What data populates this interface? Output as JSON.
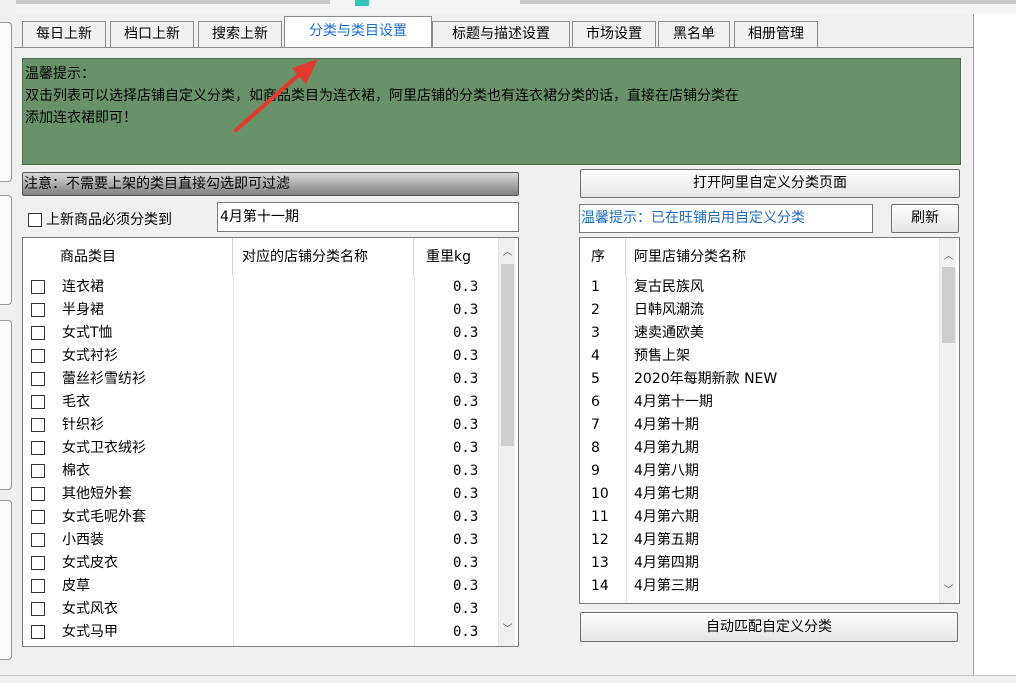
{
  "tabs": [
    "每日上新",
    "档口上新",
    "搜索上新",
    "分类与类目设置",
    "标题与描述设置",
    "市场设置",
    "黑名单",
    "相册管理"
  ],
  "active_tab_index": 3,
  "notice": {
    "title": "温馨提示：",
    "line1": "双击列表可以选择店铺自定义分类，如商品类目为连衣裙，阿里店铺的分类也有连衣裙分类的话，直接在店铺分类在",
    "line2": "添加连衣裙即可！"
  },
  "filter_hint": "注意：不需要上架的类目直接勾选即可过滤",
  "must_classify_label": "上新商品必须分类到",
  "must_classify_checked": false,
  "must_classify_value": "4月第十一期",
  "open_ali_button": "打开阿里自定义分类页面",
  "ali_hint": "温馨提示：已在旺铺启用自定义分类",
  "refresh_button": "刷新",
  "auto_match_button": "自动匹配自定义分类",
  "category_grid": {
    "headers": [
      "商品类目",
      "对应的店铺分类名称",
      "重里kg"
    ],
    "rows": [
      {
        "name": "连衣裙",
        "shop": "",
        "weight": "0.3"
      },
      {
        "name": "半身裙",
        "shop": "",
        "weight": "0.3"
      },
      {
        "name": "女式T恤",
        "shop": "",
        "weight": "0.3"
      },
      {
        "name": "女式衬衫",
        "shop": "",
        "weight": "0.3"
      },
      {
        "name": "蕾丝衫雪纺衫",
        "shop": "",
        "weight": "0.3"
      },
      {
        "name": "毛衣",
        "shop": "",
        "weight": "0.3"
      },
      {
        "name": "针织衫",
        "shop": "",
        "weight": "0.3"
      },
      {
        "name": "女式卫衣绒衫",
        "shop": "",
        "weight": "0.3"
      },
      {
        "name": "棉衣",
        "shop": "",
        "weight": "0.3"
      },
      {
        "name": "其他短外套",
        "shop": "",
        "weight": "0.3"
      },
      {
        "name": "女式毛呢外套",
        "shop": "",
        "weight": "0.3"
      },
      {
        "name": "小西装",
        "shop": "",
        "weight": "0.3"
      },
      {
        "name": "女式皮衣",
        "shop": "",
        "weight": "0.3"
      },
      {
        "name": "皮草",
        "shop": "",
        "weight": "0.3"
      },
      {
        "name": "女式风衣",
        "shop": "",
        "weight": "0.3"
      },
      {
        "name": "女式马甲",
        "shop": "",
        "weight": "0.3"
      }
    ]
  },
  "ali_grid": {
    "headers": [
      "序",
      "阿里店铺分类名称"
    ],
    "rows": [
      {
        "no": "1",
        "name": "复古民族风"
      },
      {
        "no": "2",
        "name": "日韩风潮流"
      },
      {
        "no": "3",
        "name": "速卖通欧美"
      },
      {
        "no": "4",
        "name": "预售上架"
      },
      {
        "no": "5",
        "name": "2020年每期新款 NEW"
      },
      {
        "no": "6",
        "name": "4月第十一期"
      },
      {
        "no": "7",
        "name": "4月第十期"
      },
      {
        "no": "8",
        "name": "4月第九期"
      },
      {
        "no": "9",
        "name": "4月第八期"
      },
      {
        "no": "10",
        "name": "4月第七期"
      },
      {
        "no": "11",
        "name": "4月第六期"
      },
      {
        "no": "12",
        "name": "4月第五期"
      },
      {
        "no": "13",
        "name": "4月第四期"
      },
      {
        "no": "14",
        "name": "4月第三期"
      }
    ]
  },
  "colors": {
    "notice_bg": "#6a926a",
    "active_tab_text": "#1a6fd6",
    "hint_text": "#1f6cc0",
    "annotation_arrow": "#e23a2c"
  },
  "icons": [
    "chevron-up-icon",
    "chevron-down-icon",
    "annotation-arrow"
  ]
}
